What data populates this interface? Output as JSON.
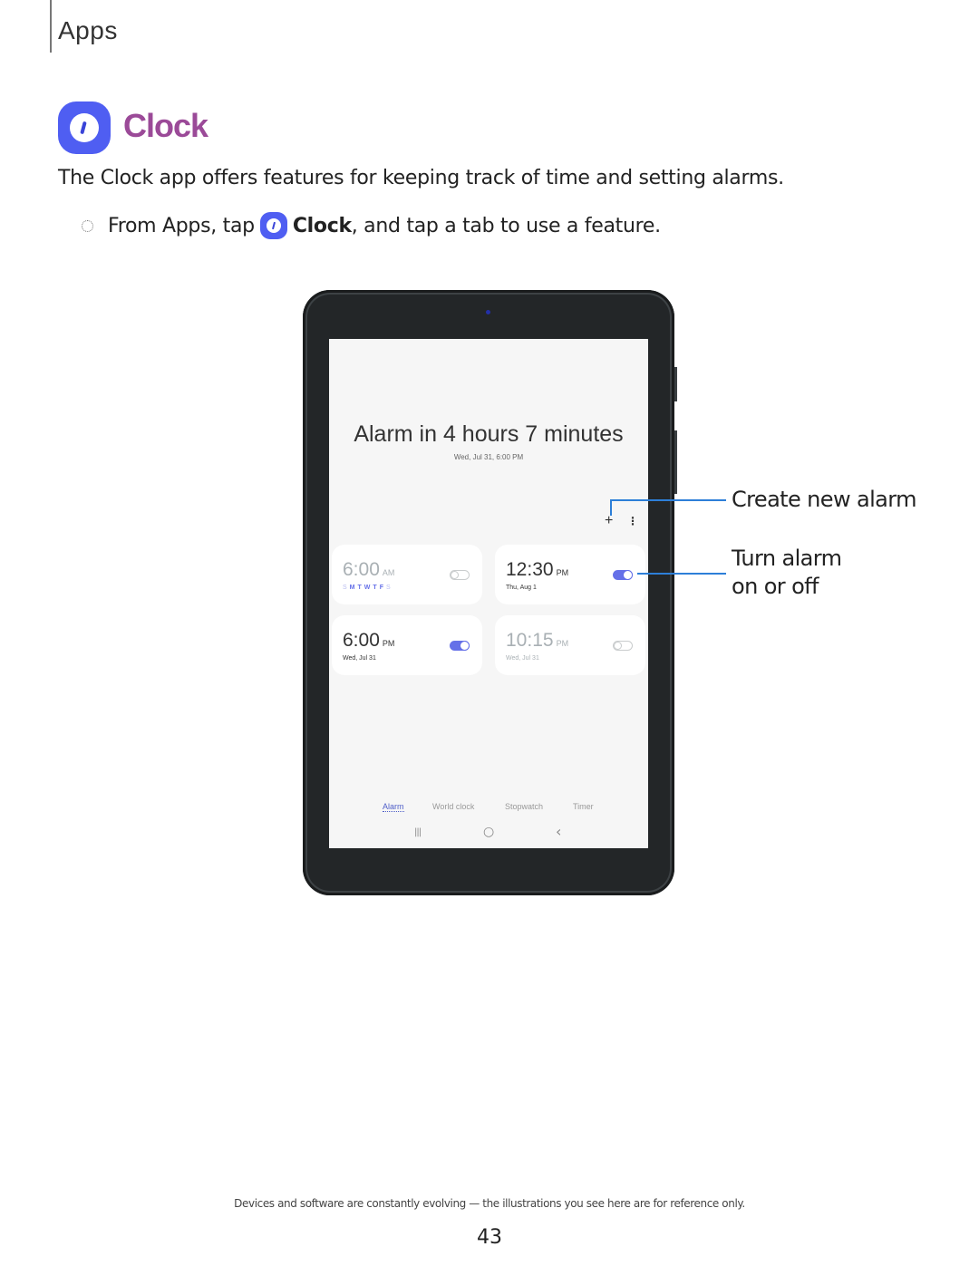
{
  "header": {
    "section": "Apps"
  },
  "title": {
    "text": "Clock",
    "icon": "clock-app-icon",
    "color": "#9b4a98",
    "icon_color": "#4f5ef2"
  },
  "intro": "The Clock app offers features for keeping track of time and setting alarms.",
  "step": {
    "prefix": "From Apps, tap",
    "app_name": "Clock",
    "suffix": ", and tap a tab to use a feature."
  },
  "device": {
    "headline": "Alarm in 4 hours 7 minutes",
    "subline": "Wed, Jul 31, 6:00 PM",
    "add_icon": "+",
    "more_icon": "⋮",
    "alarms": [
      {
        "time": "6:00",
        "ampm": "AM",
        "days": [
          "S",
          "M",
          "T",
          "W",
          "T",
          "F",
          "S"
        ],
        "enabled": false
      },
      {
        "time": "12:30",
        "ampm": "PM",
        "date": "Thu, Aug 1",
        "enabled": true
      },
      {
        "time": "6:00",
        "ampm": "PM",
        "date": "Wed, Jul 31",
        "enabled": true
      },
      {
        "time": "10:15",
        "ampm": "PM",
        "date": "Wed, Jul 31",
        "enabled": false
      }
    ],
    "tabs": [
      {
        "label": "Alarm",
        "active": true
      },
      {
        "label": "World clock",
        "active": false
      },
      {
        "label": "Stopwatch",
        "active": false
      },
      {
        "label": "Timer",
        "active": false
      }
    ],
    "nav": {
      "recents": "|||",
      "home": "○",
      "back": "‹"
    },
    "accent": "#6570e8"
  },
  "callouts": {
    "create": "Create new alarm",
    "toggle_line1": "Turn alarm",
    "toggle_line2": "on or off",
    "line_color": "#2d7fd8"
  },
  "footer": {
    "note": "Devices and software are constantly evolving — the illustrations you see here are for reference only.",
    "page_number": "43"
  }
}
